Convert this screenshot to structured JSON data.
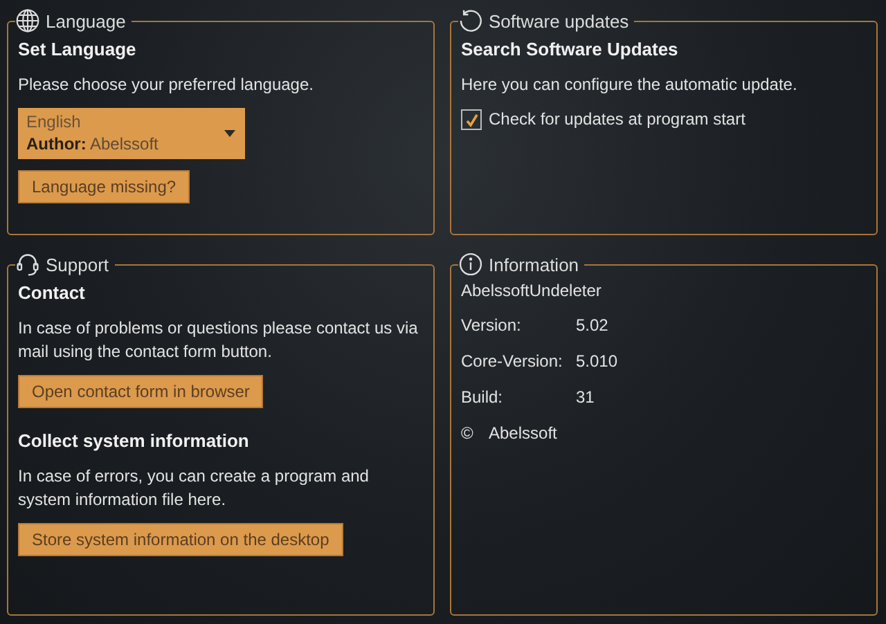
{
  "sections": [
    {
      "title": "Language",
      "kind": "globe",
      "items": [
        {
          "kind": "heading",
          "text": "Set Language"
        },
        {
          "kind": "text",
          "text": "Please choose your preferred language."
        },
        {
          "kind": "dropdown",
          "value": "English",
          "detail": "**Author:** Abelssoft"
        },
        {
          "kind": "button",
          "text": "Language missing?"
        }
      ]
    },
    {
      "title": "Software updates",
      "kind": "refresh",
      "items": [
        {
          "kind": "heading",
          "text": "Search Software Updates"
        },
        {
          "kind": "text",
          "text": "Here you can configure the automatic update."
        },
        {
          "kind": "checkbox",
          "text": "Check for updates at program start",
          "checked": true
        }
      ]
    },
    {
      "title": "Support",
      "kind": "headset",
      "items": [
        {
          "kind": "heading",
          "text": "Contact"
        },
        {
          "kind": "text",
          "text": "In case of problems or questions please contact us via mail using the contact form button."
        },
        {
          "kind": "button",
          "text": "Open contact form in browser"
        },
        {
          "kind": "heading",
          "text": "Collect system information"
        },
        {
          "kind": "text",
          "text": "In case of errors, you can create a program and system information file here."
        },
        {
          "kind": "button",
          "text": "Store system information on the desktop"
        }
      ]
    },
    {
      "title": "Information",
      "kind": "info",
      "items": [
        {
          "kind": "text",
          "text": "AbelssoftUndeleter"
        },
        {
          "kind": "info_row",
          "label": "Version:",
          "value": "5.02"
        },
        {
          "kind": "info_row",
          "label": "Core-Version:",
          "value": "5.010"
        },
        {
          "kind": "info_row",
          "label": "Build:",
          "value": "31"
        },
        {
          "kind": "copyright",
          "label": "©",
          "value": "Abelssoft"
        }
      ]
    }
  ]
}
